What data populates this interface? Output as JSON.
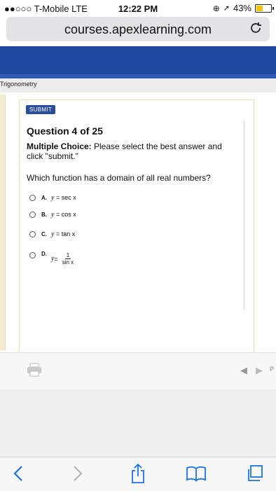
{
  "status_bar": {
    "carrier": "●●○○○ T-Mobile  LTE",
    "time": "12:22 PM",
    "battery": "43%",
    "battery_level": 0.43
  },
  "browser": {
    "url": "courses.apexlearning.com",
    "reload_icon": "reload-icon"
  },
  "course": {
    "title": "Trigonometry"
  },
  "question": {
    "submit_label": "SUBMIT",
    "title": "Question 4 of 25",
    "instruction_label": "Multiple Choice:",
    "instruction_text": " Please select the best answer and click \"submit.\"",
    "prompt": "Which function has a domain of all real numbers?",
    "choices": [
      {
        "letter": "A.",
        "lhs": "y",
        "eq": " = ",
        "rhs": "sec x"
      },
      {
        "letter": "B.",
        "lhs": "y",
        "eq": " = ",
        "rhs": "cos x"
      },
      {
        "letter": "C.",
        "lhs": "y",
        "eq": " = ",
        "rhs": "tan x"
      },
      {
        "letter": "D.",
        "lhs": "y",
        "eq": " = ",
        "numerator": "1",
        "denominator": "sin x"
      }
    ]
  },
  "toolbar": {
    "next_label": "P"
  },
  "colors": {
    "band": "#1f49a1",
    "submit": "#2a4d9c",
    "browser_accent": "#1a73e8"
  }
}
